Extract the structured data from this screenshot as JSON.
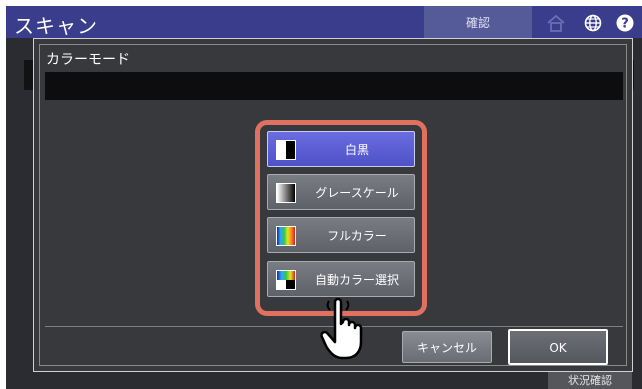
{
  "app": {
    "title": "スキャン",
    "confirm_tab": "確認",
    "status_tab": "状況確認"
  },
  "dialog": {
    "title": "カラーモード",
    "options": [
      {
        "label": "白黒",
        "icon": "black-white-swatch-icon",
        "selected": true
      },
      {
        "label": "グレースケール",
        "icon": "grayscale-swatch-icon",
        "selected": false
      },
      {
        "label": "フルカラー",
        "icon": "full-color-swatch-icon",
        "selected": false
      },
      {
        "label": "自動カラー選択",
        "icon": "auto-color-swatch-icon",
        "selected": false
      }
    ],
    "cancel_label": "キャンセル",
    "ok_label": "OK"
  },
  "icons": {
    "home": "home-icon",
    "globe": "globe-icon",
    "help": "help-icon",
    "pointer": "pointing-hand-icon"
  },
  "colors": {
    "header": "#3a3d8c",
    "selected": "#5658d2",
    "highlight_frame": "#e07060"
  }
}
